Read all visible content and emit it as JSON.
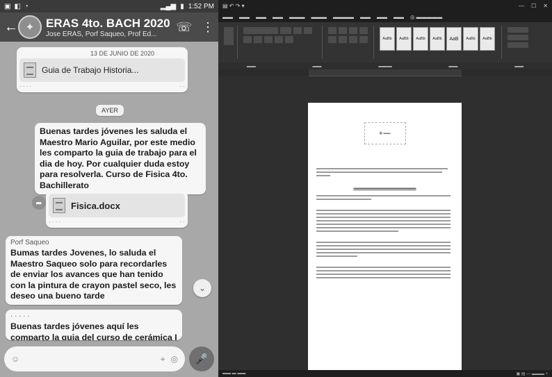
{
  "phone": {
    "status_time": "1:52 PM",
    "header": {
      "title": "ERAS 4to. BACH 2020",
      "subtitle": "Jose ERAS, Porf Saqueo, Prof Ed..."
    },
    "doc1": {
      "date": "13 DE JUNIO DE 2020",
      "name": "Guia de Trabajo Historia..."
    },
    "day_separator": "AYER",
    "message1": {
      "text": "Buenas tardes jóvenes les saluda el Maestro Mario Aguilar,  por este medio les comparto la guia de trabajo para el dia de hoy. Por cualquier duda estoy para resolverla. Curso de  Fisica 4to. Bachillerato"
    },
    "doc2": {
      "name": "Fisica.docx"
    },
    "message2": {
      "sender": "Porf Saqueo",
      "text": "Bumas tardes Jovenes, lo saluda el Maestro Saqueo solo para recordarles de enviar los avances que han tenido con la pintura de crayon pastel seco, les deseo una bueno tarde"
    },
    "message3": {
      "text": "Buenas tardes jóvenes aquí les comparto la guia del curso  de cerámica I"
    }
  },
  "colors": {
    "chat_bg": "#a8a8a8",
    "header_bg": "#4a4a4a",
    "word_bg": "#2b2b2b",
    "page_bg": "#ffffff"
  }
}
